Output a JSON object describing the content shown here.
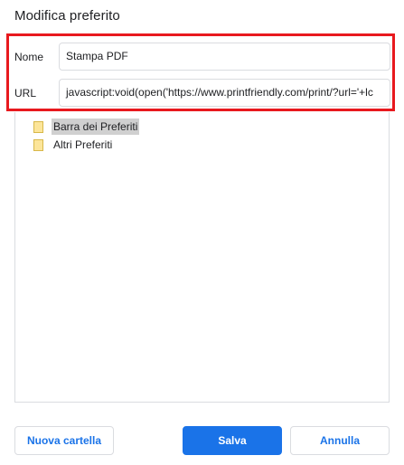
{
  "dialog": {
    "title": "Modifica preferito"
  },
  "fields": {
    "name_label": "Nome",
    "name_value": "Stampa PDF",
    "url_label": "URL",
    "url_value": "javascript:void(open('https://www.printfriendly.com/print/?url='+lc"
  },
  "tree": {
    "items": [
      {
        "label": "Barra dei Preferiti",
        "icon": "folder-icon",
        "selected": true
      },
      {
        "label": "Altri Preferiti",
        "icon": "folder-icon",
        "selected": false
      }
    ]
  },
  "buttons": {
    "new_folder": "Nuova cartella",
    "save": "Salva",
    "cancel": "Annulla"
  },
  "colors": {
    "accent": "#1a73e8",
    "highlight_border": "#e8191e",
    "folder_fill": "#fce59a",
    "folder_stroke": "#d8b84a",
    "selection_bg": "#d0d0d0"
  }
}
